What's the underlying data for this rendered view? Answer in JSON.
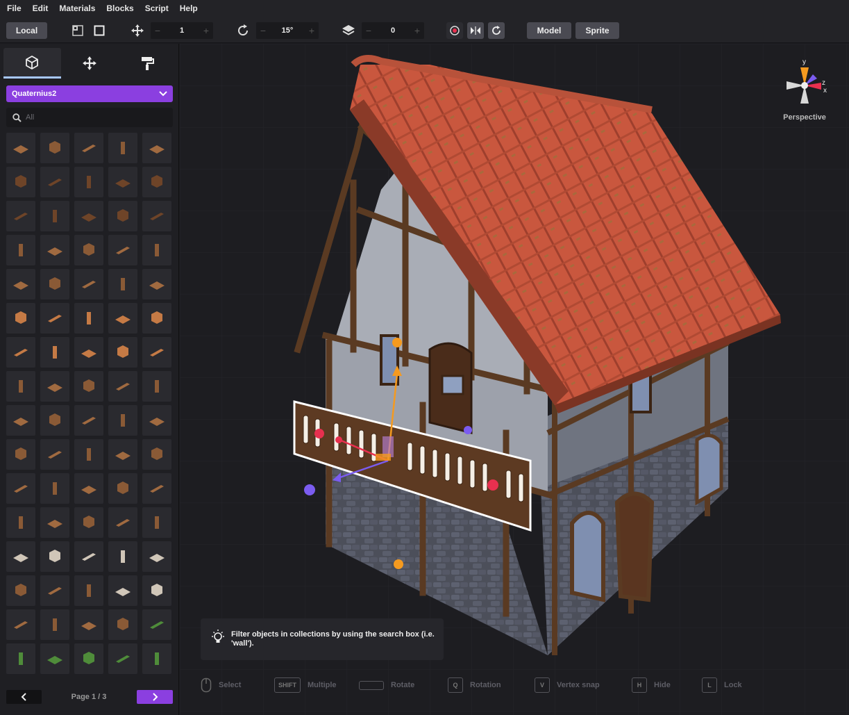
{
  "menu": [
    "File",
    "Edit",
    "Materials",
    "Blocks",
    "Script",
    "Help"
  ],
  "toolbar": {
    "space_label": "Local",
    "move_step": "1",
    "rotate_step": "15°",
    "layer": "0",
    "model_label": "Model",
    "sprite_label": "Sprite",
    "stepper_minus": "−",
    "stepper_plus": "+"
  },
  "panel": {
    "tabs": [
      {
        "icon": "cube-icon",
        "active": true
      },
      {
        "icon": "move-icon",
        "active": false
      },
      {
        "icon": "paint-roller-icon",
        "active": false
      }
    ],
    "collection": "Quaternius2",
    "search_placeholder": "All",
    "page_label": "Page 1 / 3",
    "grid_columns": 5,
    "grid_rows": 16
  },
  "viewport": {
    "view_label": "Perspective",
    "axes": {
      "y": "y",
      "z": "z",
      "x": "x"
    },
    "tip": "Filter objects in collections by using the search box (i.e. 'wall').",
    "shortcuts": [
      {
        "key": "mouse-icon",
        "label": "Select"
      },
      {
        "key": "SHIFT",
        "label": "Multiple"
      },
      {
        "key": "space-key",
        "label": "Rotate"
      },
      {
        "key": "Q",
        "label": "Rotation"
      },
      {
        "key": "V",
        "label": "Vertex snap"
      },
      {
        "key": "H",
        "label": "Hide"
      },
      {
        "key": "L",
        "label": "Lock"
      }
    ]
  },
  "colors": {
    "accent_purple": "#8b3fe0",
    "roof": "#c9573e",
    "gizmo_x": "#e8304f",
    "gizmo_y": "#f59a1f",
    "gizmo_z": "#7b5cf0"
  }
}
